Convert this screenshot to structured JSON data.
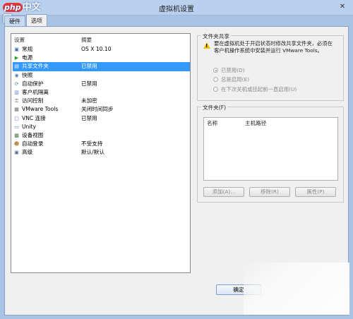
{
  "window": {
    "title": "虚拟机设置"
  },
  "watermark_logo": {
    "php": "php",
    "text": "中文网"
  },
  "tabs": [
    {
      "label": "硬件"
    },
    {
      "label": "选项"
    }
  ],
  "device_list": {
    "col_settings": "设置",
    "col_summary": "摘要",
    "rows": [
      {
        "name": "常规",
        "summary": "OS X 10.10",
        "icon": "general-icon",
        "selected": false
      },
      {
        "name": "电源",
        "summary": "",
        "icon": "power-icon",
        "selected": false
      },
      {
        "name": "共享文件夹",
        "summary": "已禁用",
        "icon": "shared-folder-icon",
        "selected": true
      },
      {
        "name": "快照",
        "summary": "",
        "icon": "snapshot-icon",
        "selected": false
      },
      {
        "name": "自动保护",
        "summary": "已禁用",
        "icon": "autoprotect-icon",
        "selected": false
      },
      {
        "name": "客户机隔离",
        "summary": "",
        "icon": "isolation-icon",
        "selected": false
      },
      {
        "name": "访问控制",
        "summary": "未加密",
        "icon": "access-control-icon",
        "selected": false
      },
      {
        "name": "VMware Tools",
        "summary": "关闭时间同步",
        "icon": "vmware-tools-icon",
        "selected": false
      },
      {
        "name": "VNC 连接",
        "summary": "已禁用",
        "icon": "vnc-icon",
        "selected": false
      },
      {
        "name": "Unity",
        "summary": "",
        "icon": "unity-icon",
        "selected": false
      },
      {
        "name": "设备视图",
        "summary": "",
        "icon": "device-view-icon",
        "selected": false
      },
      {
        "name": "自动登录",
        "summary": "不受支持",
        "icon": "autologin-icon",
        "selected": false
      },
      {
        "name": "高级",
        "summary": "默认/默认",
        "icon": "advanced-icon",
        "selected": false
      }
    ]
  },
  "folder_sharing": {
    "title": "文件夹共享",
    "warning": "要在虚拟机处于开启状态时修改共享文件夹，必须在客户机操作系统中安装并运行 VMware Tools。",
    "options": [
      {
        "label": "已禁用(D)",
        "checked": true
      },
      {
        "label": "总是启用(E)",
        "checked": false
      },
      {
        "label": "在下次关机或挂起前一直启用(U)",
        "checked": false
      }
    ]
  },
  "folders": {
    "title": "文件夹(F)",
    "col_name": "名称",
    "col_host_path": "主机路径",
    "add_button": "添加(A)...",
    "remove_button": "移除(R)",
    "properties_button": "属性(P)"
  },
  "footer": {
    "ok_button": "确定"
  }
}
